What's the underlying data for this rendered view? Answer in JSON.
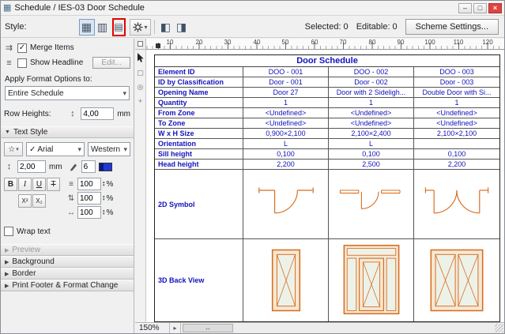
{
  "window": {
    "title": "Schedule / IES-03 Door Schedule"
  },
  "titlebar": {
    "minimize": "–",
    "maximize": "□",
    "close": "×"
  },
  "toolbar": {
    "style_label": "Style:",
    "selected": "Selected: 0",
    "editable": "Editable: 0",
    "scheme_settings": "Scheme Settings..."
  },
  "sidebar": {
    "merge_items": "Merge Items",
    "show_headline": "Show Headline",
    "edit": "Edit...",
    "apply_format_label": "Apply Format Options to:",
    "apply_format_value": "Entire Schedule",
    "row_heights_label": "Row Heights:",
    "row_height_value": "4,00",
    "unit_mm": "mm",
    "text_style_header": "Text Style",
    "font_name": "Arial",
    "font_script": "Western",
    "font_size": "2,00",
    "pen_number": "6",
    "bold": "B",
    "italic": "I",
    "underline": "U",
    "strike": "T",
    "superscript": "X²",
    "subscript": "X₂",
    "spacing1": "100",
    "spacing2": "100",
    "spacing3": "100",
    "percent": "%",
    "wrap_text": "Wrap text",
    "sections": {
      "preview": "Preview",
      "background": "Background",
      "border": "Border",
      "print_footer": "Print Footer & Format Change"
    }
  },
  "ruler": {
    "ticks": [
      "10",
      "20",
      "30",
      "40",
      "50",
      "60",
      "70",
      "80",
      "90",
      "100",
      "110",
      "120"
    ]
  },
  "table": {
    "title": "Door Schedule",
    "rows": [
      {
        "label": "Element ID",
        "values": [
          "DOO - 001",
          "DOO - 002",
          "DOO - 003"
        ]
      },
      {
        "label": "ID by Classification",
        "values": [
          "Door - 001",
          "Door - 002",
          "Door - 003"
        ]
      },
      {
        "label": "Opening Name",
        "values": [
          "Door 27",
          "Door with 2 Sideligh...",
          "Double Door with Si..."
        ]
      },
      {
        "label": "Quantity",
        "values": [
          "1",
          "1",
          "1"
        ]
      },
      {
        "label": "From Zone",
        "values": [
          "<Undefined>",
          "<Undefined>",
          "<Undefined>"
        ]
      },
      {
        "label": "To Zone",
        "values": [
          "<Undefined>",
          "<Undefined>",
          "<Undefined>"
        ]
      },
      {
        "label": "W x H Size",
        "values": [
          "0,900×2,100",
          "2,100×2,400",
          "2,100×2,100"
        ]
      },
      {
        "label": "Orientation",
        "values": [
          "L",
          "L",
          ""
        ]
      },
      {
        "label": "Sill height",
        "values": [
          "0,100",
          "0,100",
          "0,100"
        ]
      },
      {
        "label": "Head height",
        "values": [
          "2,200",
          "2,500",
          "2,200"
        ]
      }
    ],
    "symbol_label": "2D Symbol",
    "back_view_label": "3D Back View"
  },
  "statusbar": {
    "zoom": "150%"
  },
  "colors": {
    "schedule_text": "#1212bd",
    "element_orange": "#d96c1f",
    "highlight_red": "#e40000"
  },
  "icons": {
    "app": "▦",
    "view_table": "▦",
    "view_grid": "▥",
    "tool_highlighted": "▤",
    "header_top": "◧",
    "header_left": "◨",
    "dropdown": "▾",
    "collapsed": "▶",
    "expanded": "▼",
    "check": "✓",
    "star": "☆",
    "merge": "⇉",
    "headline": "≡",
    "row_height": "↕",
    "text_size": "↕",
    "line_spacing": "≡",
    "row_gap": "⇅",
    "tracking": "↔",
    "step_up": "▴",
    "step_down": "▾",
    "scroll_right": "▸",
    "scroll_handle": "↔",
    "pointer": "➤",
    "marquee": "▢",
    "zoom_tool": "◎",
    "pan_tool": "+"
  }
}
